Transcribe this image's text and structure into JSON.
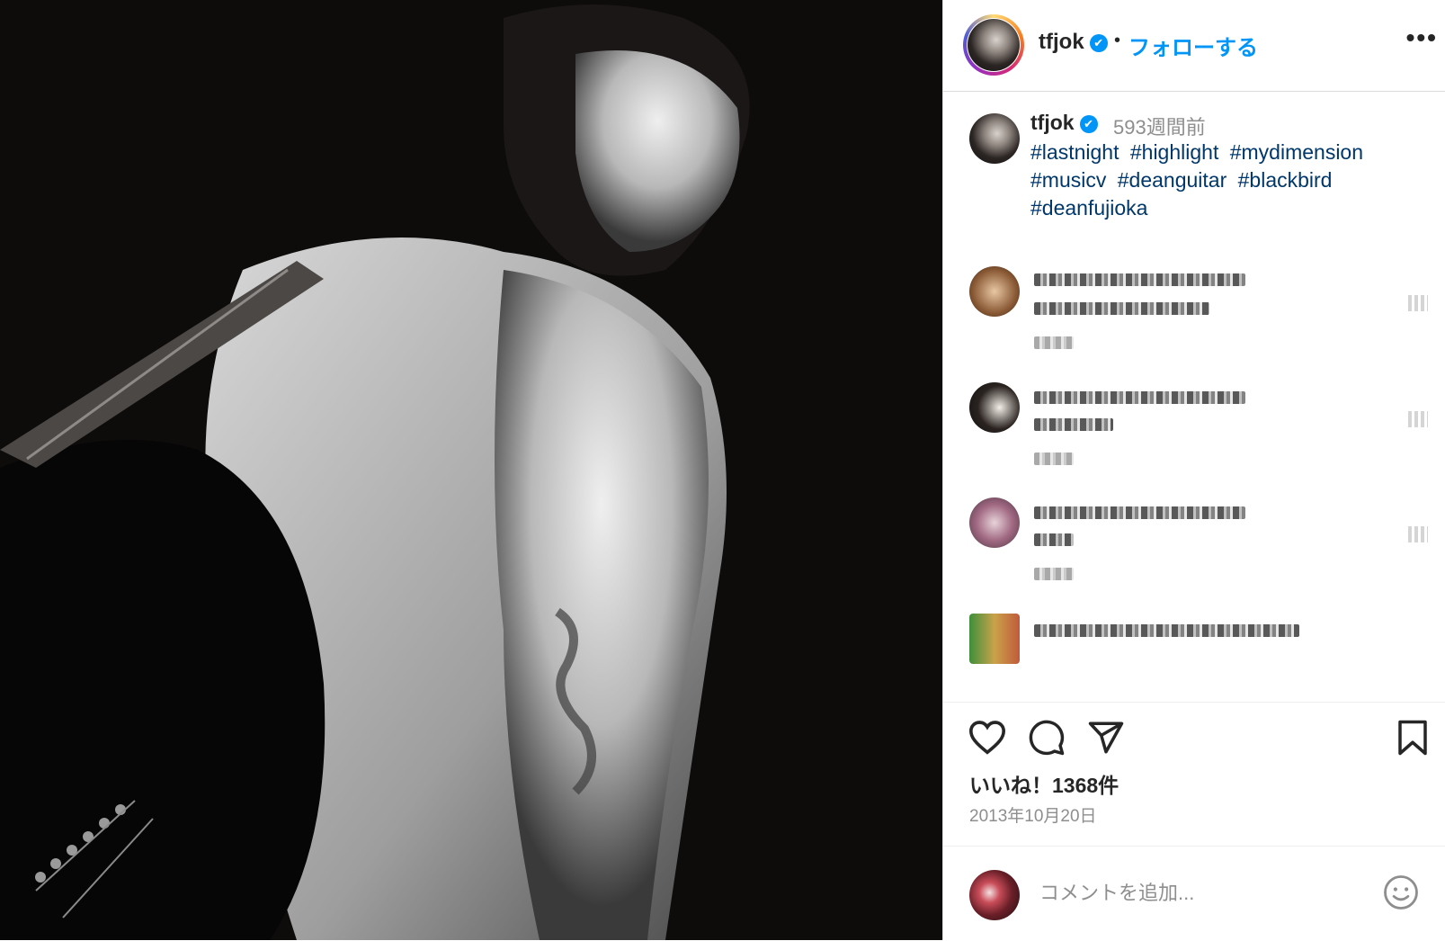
{
  "post": {
    "image_alt": "",
    "account": {
      "username": "tfjok",
      "verified_glyph": "✔",
      "separator": "•",
      "follow_label": "フォローする",
      "more_label": "•••"
    },
    "caption": {
      "username": "tfjok",
      "time_ago": "593週間前",
      "hashtags": [
        "#lastnight",
        "#highlight",
        "#mydimension",
        "#musicv",
        "#deanguitar",
        "#blackbird",
        "#deanfujioka"
      ]
    },
    "likes_text": "いいね！1368件",
    "date_text": "2013年10月20日",
    "comment_placeholder": "コメントを追加...",
    "icons": [
      "heart-icon",
      "comment-icon",
      "share-icon",
      "bookmark-icon",
      "emoji-icon"
    ]
  }
}
